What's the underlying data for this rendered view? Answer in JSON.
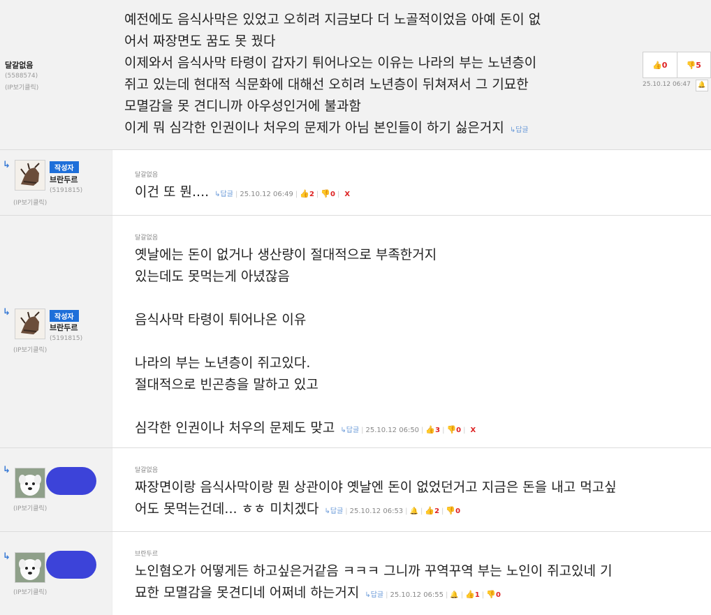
{
  "comments": [
    {
      "author": "달갈없음",
      "user_id": "(5588574)",
      "ip_label": "(IP보기클릭)",
      "lines": [
        "예전에도 음식사막은 있었고 오히려 지금보다 더 노골적이었음 아예 돈이 없",
        "어서 짜장면도 꿈도 못 꿨다",
        "이제와서 음식사막 타령이 갑자기 튀어나오는 이유는 나라의 부는 노년층이",
        "쥐고 있는데 현대적 식문화에 대해선 오히려 노년층이 뒤쳐져서 그 기묘한",
        "모멸감을 못 견디니까 아우성인거에 불과함",
        "이게 뭐 심각한 인권이나 처우의 문제가 아님 본인들이 하기 싫은거지"
      ],
      "reply_label": "↳답글",
      "upvotes": "0",
      "downvotes": "5",
      "date": "25.10.12 06:47"
    },
    {
      "badge": "작성자",
      "author": "브란두르",
      "user_id": "(5191815)",
      "ip_label": "(IP보기클릭)",
      "parent": "달갈없음",
      "lines": [
        "이건 또 뭔...."
      ],
      "reply_label": "↳답글",
      "date": "25.10.12 06:49",
      "upvotes": "2",
      "downvotes": "0",
      "delete_label": "X"
    },
    {
      "badge": "작성자",
      "author": "브란두르",
      "user_id": "(5191815)",
      "ip_label": "(IP보기클릭)",
      "parent": "달갈없음",
      "lines": [
        "옛날에는 돈이 없거나 생산량이 절대적으로 부족한거지",
        "있는데도 못먹는게 아녔잖음",
        "",
        "음식사막 타령이 튀어나온 이유",
        "",
        "나라의 부는 노년층이 쥐고있다.",
        "절대적으로 빈곤층을 말하고 있고",
        "",
        "심각한 인권이나 처우의 문제도 맞고"
      ],
      "reply_label": "↳답글",
      "date": "25.10.12 06:50",
      "upvotes": "3",
      "downvotes": "0",
      "delete_label": "X"
    },
    {
      "author": "",
      "user_id": "",
      "ip_label": "(IP보기클릭)",
      "parent": "달갈없음",
      "lines": [
        "짜장면이랑 음식사막이랑 뭔 상관이야 옛날엔 돈이 없었던거고 지금은 돈을 내고 먹고싶",
        "어도 못먹는건데... ㅎㅎ 미치겠다"
      ],
      "reply_label": "↳답글",
      "date": "25.10.12 06:53",
      "upvotes": "2",
      "downvotes": "0"
    },
    {
      "author": "",
      "user_id": "",
      "ip_label": "(IP보기클릭)",
      "parent": "브란두르",
      "lines": [
        "노인혐오가 어떻게든 하고싶은거같음 ㅋㅋㅋ 그니까 꾸역꾸역 부는 노인이 쥐고있네 기",
        "묘한 모멸감을 못견디네 어쩌네 하는거지"
      ],
      "reply_label": "↳답글",
      "date": "25.10.12 06:55",
      "upvotes": "1",
      "downvotes": "0"
    }
  ],
  "icons": {
    "reply_arrow": "↳",
    "thumb_up": "👍",
    "thumb_down": "👎",
    "bell": "🔔"
  },
  "colors": {
    "accent": "#1e6fd9",
    "vote": "#dd2222",
    "blob": "#3c43d9"
  }
}
